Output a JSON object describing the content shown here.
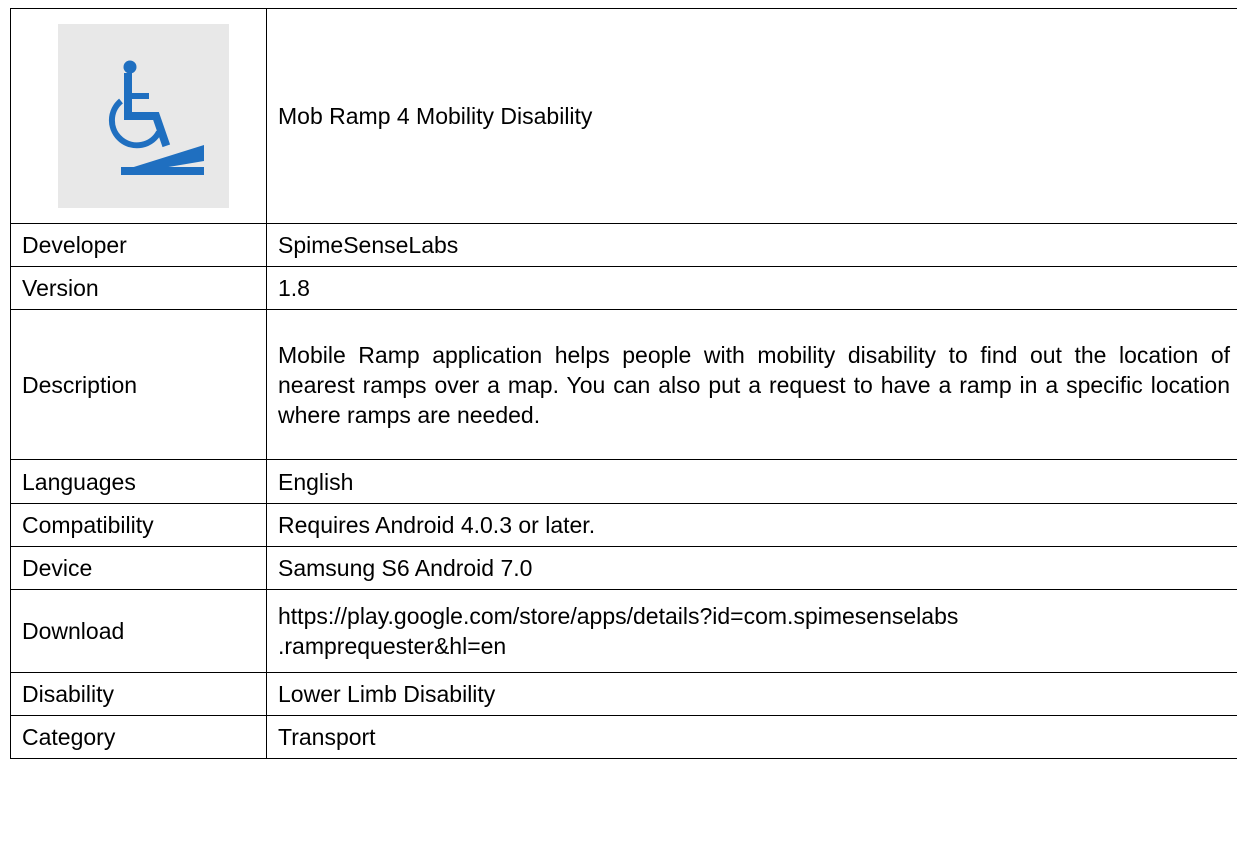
{
  "app": {
    "name": "Mob Ramp 4 Mobility Disability",
    "icon": "wheelchair-ramp-icon",
    "icon_color": "#1f6fc0",
    "icon_bg": "#e8e8e8"
  },
  "rows": [
    {
      "label": "Developer",
      "value": "SpimeSenseLabs"
    },
    {
      "label": "Version",
      "value": "1.8"
    },
    {
      "label": "Description",
      "value": "Mobile Ramp application helps people with mobility disability to find out the location of nearest ramps over a map. You can also put a request to have a ramp in a specific location where ramps are needed."
    },
    {
      "label": "Languages",
      "value": "English"
    },
    {
      "label": "Compatibility",
      "value": "Requires Android 4.0.3 or later."
    },
    {
      "label": "Device",
      "value": "Samsung S6 Android 7.0"
    },
    {
      "label": "Download",
      "value": "https://play.google.com/store/apps/details?id=com.spimesenselabs\n.ramprequester&hl=en"
    },
    {
      "label": "Disability",
      "value": "Lower Limb Disability"
    },
    {
      "label": "Category",
      "value": "Transport"
    }
  ]
}
